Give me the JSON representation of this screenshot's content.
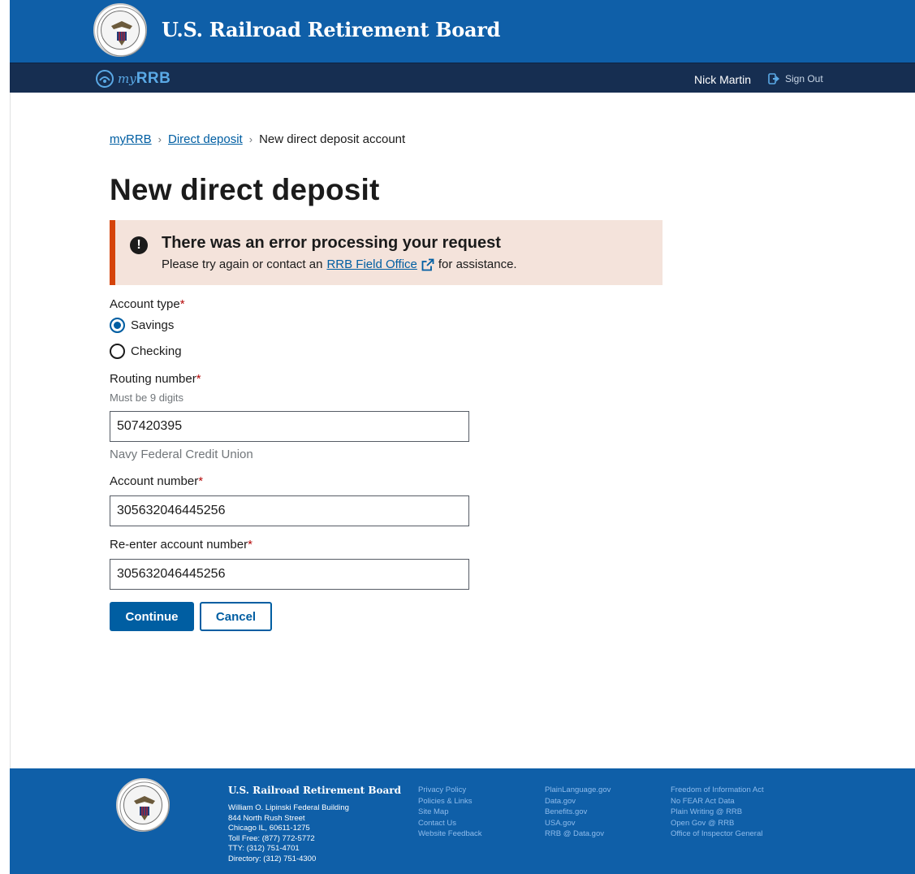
{
  "header": {
    "title": "U.S. Railroad Retirement Board"
  },
  "subnav": {
    "logo_my": "my",
    "logo_rrb": "RRB",
    "user_name": "Nick Martin",
    "sign_out_label": "Sign Out"
  },
  "breadcrumb": {
    "items": [
      "myRRB",
      "Direct deposit"
    ],
    "current": "New direct deposit account"
  },
  "page_title": "New direct deposit",
  "alert": {
    "heading": "There was an error processing your request",
    "text_before": "Please try again or contact an",
    "link": "RRB Field Office",
    "text_after": "for assistance."
  },
  "form": {
    "account_type": {
      "label": "Account type",
      "required_mark": "*",
      "options": [
        "Savings",
        "Checking"
      ],
      "selected": "Savings"
    },
    "routing": {
      "label": "Routing number",
      "required_mark": "*",
      "hint": "Must be 9 digits",
      "value": "507420395",
      "bank_name": "Navy Federal Credit Union"
    },
    "account": {
      "label": "Account number",
      "required_mark": "*",
      "value": "305632046445256"
    },
    "reenter": {
      "label": "Re-enter account number",
      "required_mark": "*",
      "value": "305632046445256"
    },
    "continue_label": "Continue",
    "cancel_label": "Cancel"
  },
  "footer": {
    "org": "U.S. Railroad Retirement Board",
    "address": [
      "William O. Lipinski Federal Building",
      "844 North Rush Street",
      "Chicago IL, 60611-1275",
      "Toll Free: (877) 772-5772",
      "TTY: (312) 751-4701",
      "Directory: (312) 751-4300"
    ],
    "col1": [
      "Privacy Policy",
      "Policies & Links",
      "Site Map",
      "Contact Us",
      "Website Feedback"
    ],
    "col2": [
      "PlainLanguage.gov",
      "Data.gov",
      "Benefits.gov",
      "USA.gov",
      "RRB @ Data.gov"
    ],
    "col3": [
      "Freedom of Information Act",
      "No FEAR Act Data",
      "Plain Writing @ RRB",
      "Open Gov @ RRB",
      "Office of Inspector General"
    ]
  },
  "colors": {
    "header_blue": "#0f5fa8",
    "subnav_navy": "#162e51",
    "primary": "#005ea2",
    "error_border": "#d54309",
    "error_bg": "#f4e3db"
  },
  "icons": {
    "seal": "rrb-seal-icon",
    "logo": "myrrb-logo-icon",
    "sign_out": "sign-out-icon",
    "alert": "error-icon",
    "external": "external-link-icon"
  }
}
